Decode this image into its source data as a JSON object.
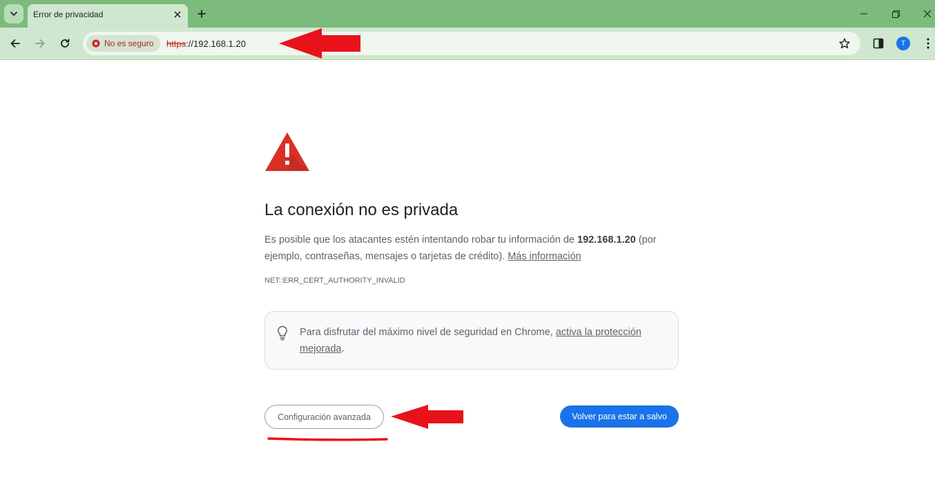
{
  "colors": {
    "frame": "#7cbb7b",
    "toolbar": "#cfe7ce",
    "danger": "#c5221f",
    "warning_icon": "#d93025",
    "primary_button": "#1a73e8",
    "annotation": "#e8121b"
  },
  "tab": {
    "title": "Error de privacidad",
    "close_icon": "close-icon"
  },
  "toolbar": {
    "security_label": "No es seguro",
    "url_scheme": "https",
    "url_rest": "://192.168.1.20",
    "avatar_initial": "T"
  },
  "interstitial": {
    "heading": "La conexión no es privada",
    "explanation_prefix": "Es posible que los atacantes estén intentando robar tu información de ",
    "host": "192.168.1.20",
    "explanation_suffix": " (por ejemplo, contraseñas, mensajes o tarjetas de crédito). ",
    "learn_more": "Más información",
    "error_code": "NET::ERR_CERT_AUTHORITY_INVALID",
    "promo_prefix": "Para disfrutar del máximo nivel de seguridad en Chrome, ",
    "promo_link": "activa la protección mejorada",
    "promo_suffix": ".",
    "advanced_button": "Configuración avanzada",
    "back_button": "Volver para estar a salvo"
  }
}
